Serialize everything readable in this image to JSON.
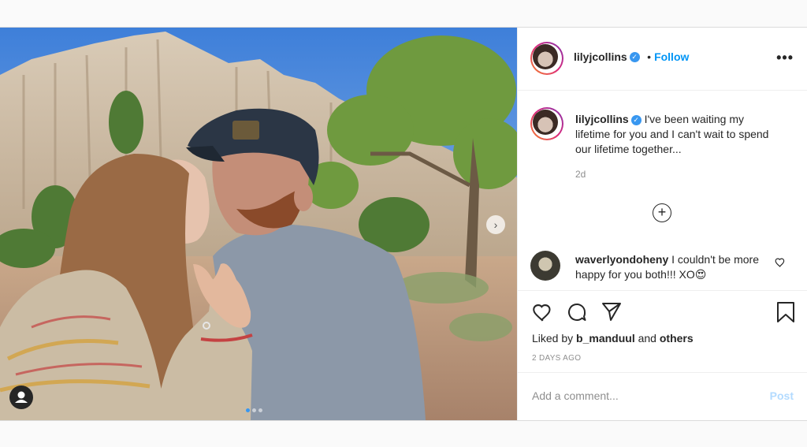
{
  "post": {
    "author": "lilyjcollins",
    "follow_label": "Follow",
    "more_label": "•••",
    "caption": "I've been waiting my lifetime for you and I can't wait to spend our lifetime together...",
    "caption_time": "2d",
    "comment": {
      "author": "waverlyondoheny",
      "text": "I couldn't be more happy for you both!!! XO😍"
    },
    "liked_by_prefix": "Liked by ",
    "liked_by_user": "b_manduul",
    "liked_by_and": " and ",
    "liked_by_others": "others",
    "posted_ago": "2 DAYS AGO",
    "add_comment_placeholder": "Add a comment...",
    "post_button": "Post",
    "carousel_next": "›",
    "carousel_count": 3,
    "carousel_active": 1
  },
  "icons": {
    "verified": "verified-badge-icon",
    "heart": "heart-icon",
    "comment": "comment-icon",
    "share": "share-icon",
    "save": "bookmark-icon",
    "load_more": "plus-circle-icon",
    "tagged_user": "user-icon"
  },
  "colors": {
    "accent": "#0095f6",
    "verified": "#3897f0",
    "post_disabled": "#b3dbff"
  }
}
